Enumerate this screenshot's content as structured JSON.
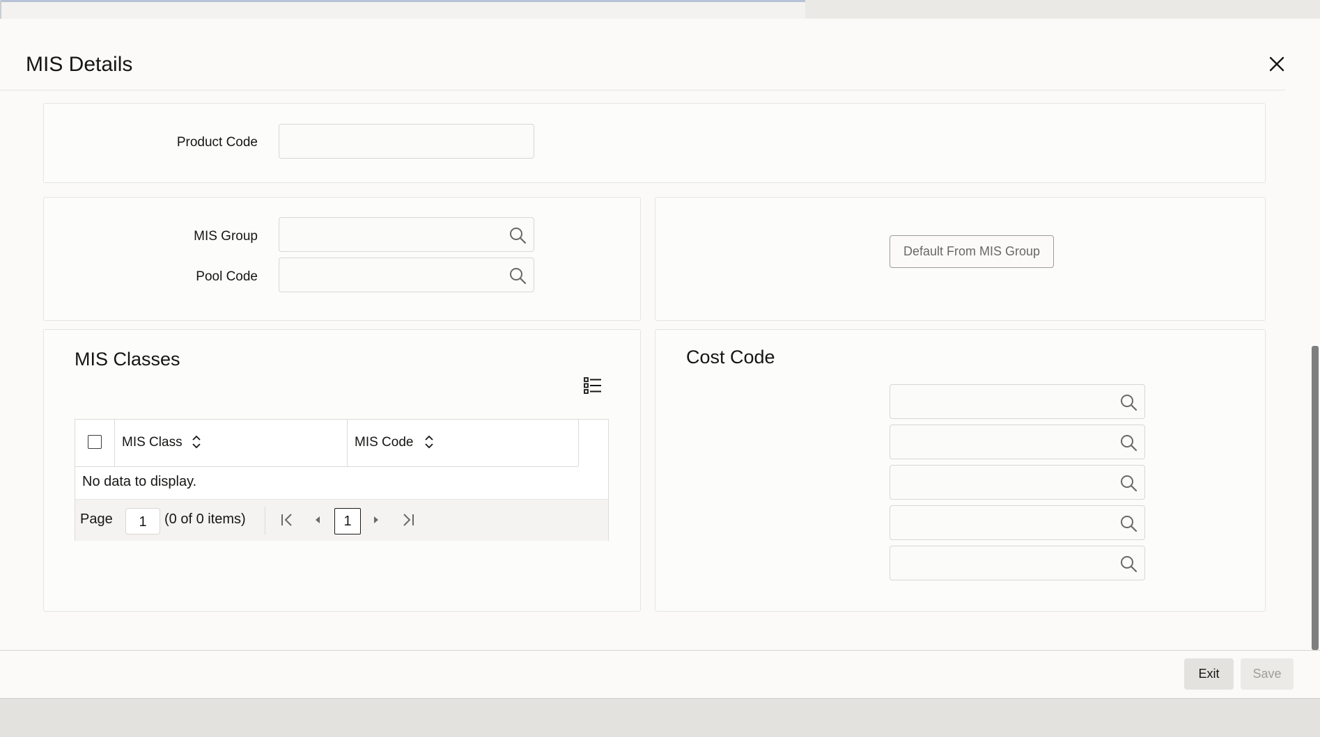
{
  "dialog": {
    "title": "MIS Details",
    "close_label": "close"
  },
  "product": {
    "label": "Product Code",
    "value": ""
  },
  "mis": {
    "group_label": "MIS Group",
    "group_value": "",
    "pool_label": "Pool Code",
    "pool_value": "",
    "default_button": "Default From MIS Group"
  },
  "mis_classes": {
    "title": "MIS Classes",
    "columns": [
      "MIS Class",
      "MIS Code"
    ],
    "rows": [],
    "empty_text": "No data to display.",
    "pager": {
      "page_label": "Page",
      "page_input": "1",
      "info": "(0 of 0 items)",
      "current": "1"
    }
  },
  "cost_code": {
    "title": "Cost Code",
    "fields": [
      "",
      "",
      "",
      "",
      ""
    ]
  },
  "footer": {
    "exit": "Exit",
    "save": "Save"
  },
  "icons": {
    "lov": "search-icon",
    "close": "close-icon",
    "list": "list-view-icon",
    "sort": "sort-icon"
  },
  "colors": {
    "accent": "#161513",
    "border": "#d9d7d3",
    "scrollbar": "#7f7f7f"
  }
}
